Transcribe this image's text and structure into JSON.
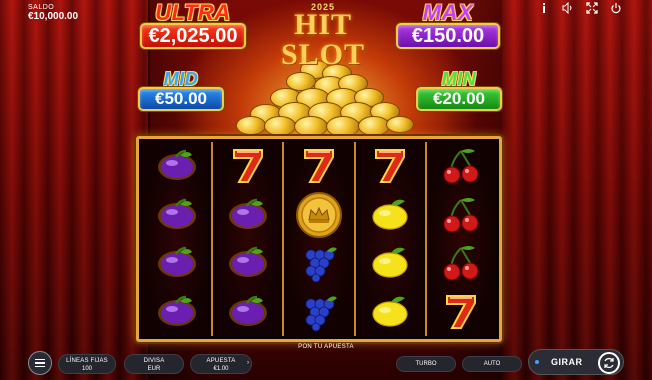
{
  "balance": {
    "label": "SALDO",
    "value": "€10,000.00"
  },
  "topbar": {
    "icons": [
      {
        "name": "info-icon",
        "glyph": "ℹ"
      },
      {
        "name": "sound-icon",
        "glyph": "🔈"
      },
      {
        "name": "fullscreen-icon",
        "glyph": "⤢"
      },
      {
        "name": "power-icon",
        "glyph": "⏻"
      }
    ]
  },
  "logo": {
    "year": "2025",
    "name": "HIT SLOT"
  },
  "jackpots": {
    "ultra": {
      "title": "ULTRA",
      "amount": "€2,025.00",
      "color": "#ff2a1a"
    },
    "max": {
      "title": "MAX",
      "amount": "€150.00",
      "color": "#b23ae8"
    },
    "mid": {
      "title": "MID",
      "amount": "€50.00",
      "color": "#2b8ff0"
    },
    "min": {
      "title": "MIN",
      "amount": "€20.00",
      "color": "#3fcf3a"
    }
  },
  "reels": [
    [
      "plum",
      "plum",
      "plum",
      "plum"
    ],
    [
      "seven",
      "plum",
      "plum",
      "plum"
    ],
    [
      "seven",
      "crown-coin",
      "grapes",
      "grapes"
    ],
    [
      "seven",
      "lemon",
      "lemon",
      "lemon"
    ],
    [
      "cherry",
      "cherry",
      "cherry",
      "seven"
    ]
  ],
  "bottom": {
    "hint": "PON TU APUESTA",
    "lines_label": "LÍNEAS FIJAS",
    "lines_value": "100",
    "currency_label": "DIVISA",
    "currency_value": "EUR",
    "bet_label": "APUESTA",
    "bet_value": "€1.00",
    "turbo": "TURBO",
    "auto": "AUTO",
    "spin": "GIRAR"
  }
}
